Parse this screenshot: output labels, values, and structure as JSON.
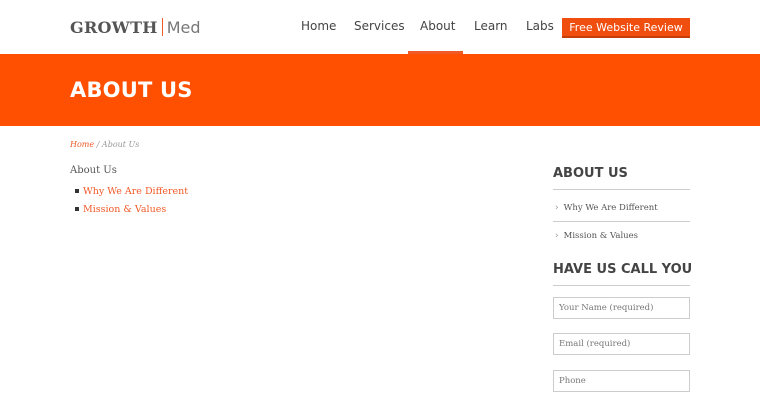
{
  "header": {
    "logo_primary": "GROWTH",
    "logo_secondary": "Med",
    "nav": [
      {
        "label": "Home"
      },
      {
        "label": "Services"
      },
      {
        "label": "About",
        "active": true
      },
      {
        "label": "Learn"
      },
      {
        "label": "Labs"
      }
    ],
    "cta_label": "Free Website Review"
  },
  "banner": {
    "title": "ABOUT US"
  },
  "breadcrumb": {
    "home": "Home",
    "separator": "/",
    "current": "About Us"
  },
  "main": {
    "heading": "About Us",
    "links": [
      {
        "label": "Why We Are Different"
      },
      {
        "label": "Mission & Values"
      }
    ]
  },
  "sidebar": {
    "about_title": "ABOUT US",
    "about_items": [
      {
        "label": "Why We Are Different"
      },
      {
        "label": "Mission & Values"
      }
    ],
    "call_title": "HAVE US CALL YOU",
    "fields": [
      {
        "placeholder": "Your Name (required)"
      },
      {
        "placeholder": "Email (required)"
      },
      {
        "placeholder": "Phone"
      }
    ]
  },
  "colors": {
    "accent": "#fe5000",
    "link": "#f05a28",
    "text": "#555555"
  }
}
